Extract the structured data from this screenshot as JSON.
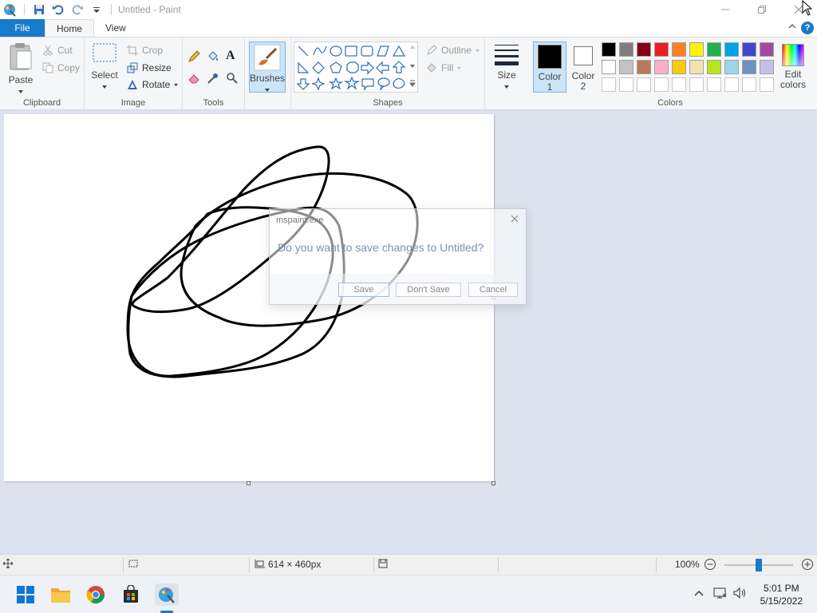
{
  "app": {
    "title": "Untitled - Paint"
  },
  "tabs": {
    "file": "File",
    "home": "Home",
    "view": "View"
  },
  "ribbon": {
    "clipboard": {
      "paste": "Paste",
      "cut": "Cut",
      "copy": "Copy",
      "label": "Clipboard"
    },
    "image": {
      "select": "Select",
      "crop": "Crop",
      "resize": "Resize",
      "rotate": "Rotate",
      "label": "Image"
    },
    "tools": {
      "label": "Tools"
    },
    "brushes": {
      "label": "Brushes"
    },
    "shapes": {
      "outline": "Outline",
      "fill": "Fill",
      "label": "Shapes"
    },
    "size": {
      "label": "Size"
    },
    "color1": {
      "line1": "Color",
      "line2": "1"
    },
    "color2": {
      "line1": "Color",
      "line2": "2"
    },
    "colors": {
      "label": "Colors",
      "edit_line1": "Edit",
      "edit_line2": "colors",
      "row1": [
        "#000000",
        "#7f7f7f",
        "#880015",
        "#ed1c24",
        "#ff7f27",
        "#fff200",
        "#22b14c",
        "#00a2e8",
        "#3f48cc",
        "#a349a4"
      ],
      "row2": [
        "#ffffff",
        "#c3c3c3",
        "#b97a57",
        "#ffaec9",
        "#ffc90e",
        "#efe4b0",
        "#b5e61d",
        "#99d9ea",
        "#7092be",
        "#c8bfe7"
      ]
    }
  },
  "dialog": {
    "title": "mspaint.exe",
    "message": "Do you want to save changes to Untitled?",
    "save": "Save",
    "dont_save": "Don't Save",
    "cancel": "Cancel"
  },
  "status": {
    "dimensions": "614 × 460px",
    "zoom": "100%",
    "zoom_level": 0.5
  },
  "taskbar": {
    "time": "5:01 PM",
    "date": "5/15/2022"
  },
  "colors": {
    "accent": "#1979ca",
    "workspace": "#dce3ee"
  }
}
